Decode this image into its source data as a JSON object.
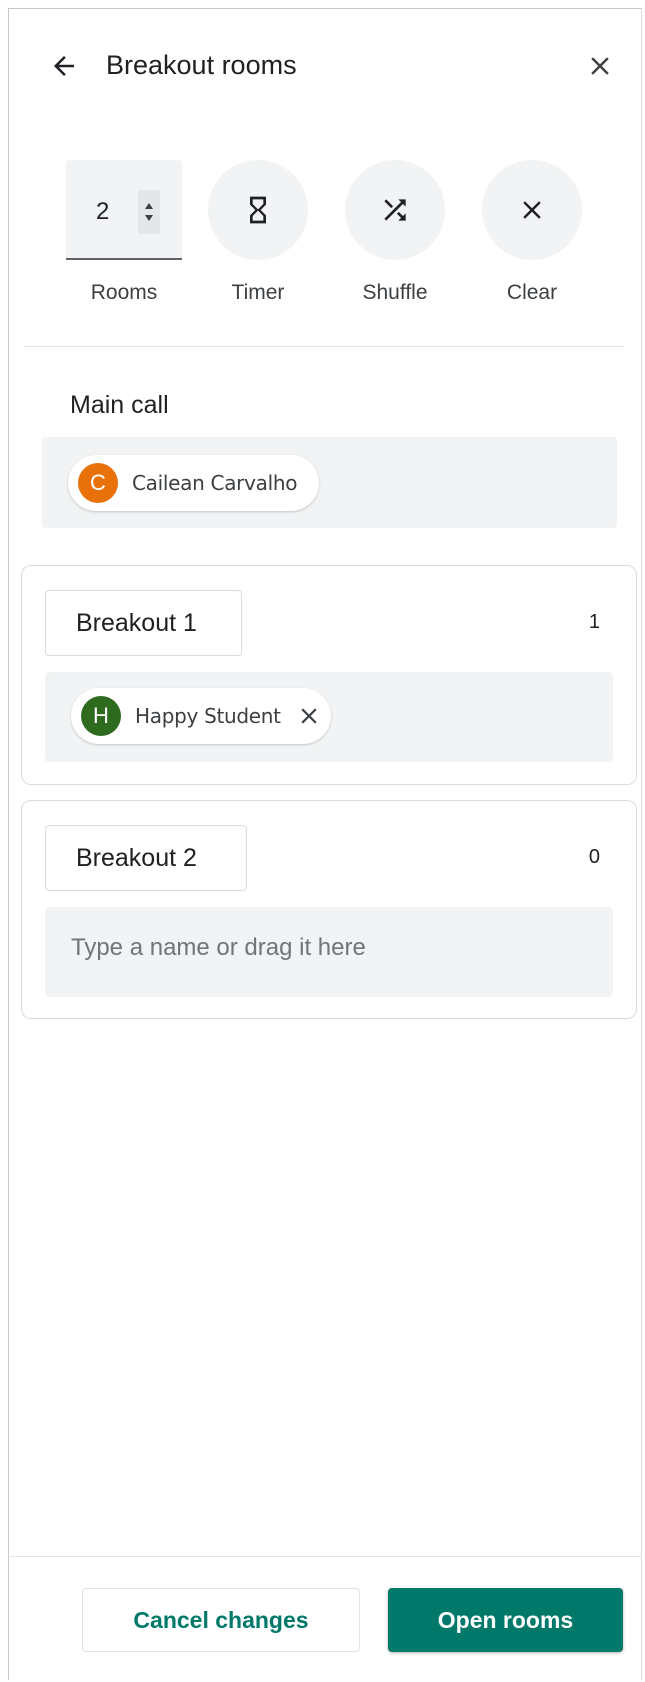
{
  "header": {
    "title": "Breakout rooms",
    "back_icon": "arrow-back-icon",
    "close_icon": "close-icon"
  },
  "controls": {
    "rooms_value": "2",
    "rooms_label": "Rooms",
    "timer_label": "Timer",
    "shuffle_label": "Shuffle",
    "clear_label": "Clear"
  },
  "main_call": {
    "title": "Main call",
    "participants": [
      {
        "initial": "C",
        "name": "Cailean Carvalho",
        "color": "#e8710a"
      }
    ]
  },
  "rooms": [
    {
      "name": "Breakout 1",
      "count": "1",
      "participants": [
        {
          "initial": "H",
          "name": "Happy Student",
          "color": "#2e6b1f"
        }
      ]
    },
    {
      "name": "Breakout 2",
      "count": "0",
      "placeholder": "Type a name or drag it here"
    }
  ],
  "footer": {
    "cancel_label": "Cancel changes",
    "open_label": "Open rooms"
  },
  "colors": {
    "accent": "#00796b",
    "surface": "#f1f3f4",
    "border": "#dadce0"
  }
}
